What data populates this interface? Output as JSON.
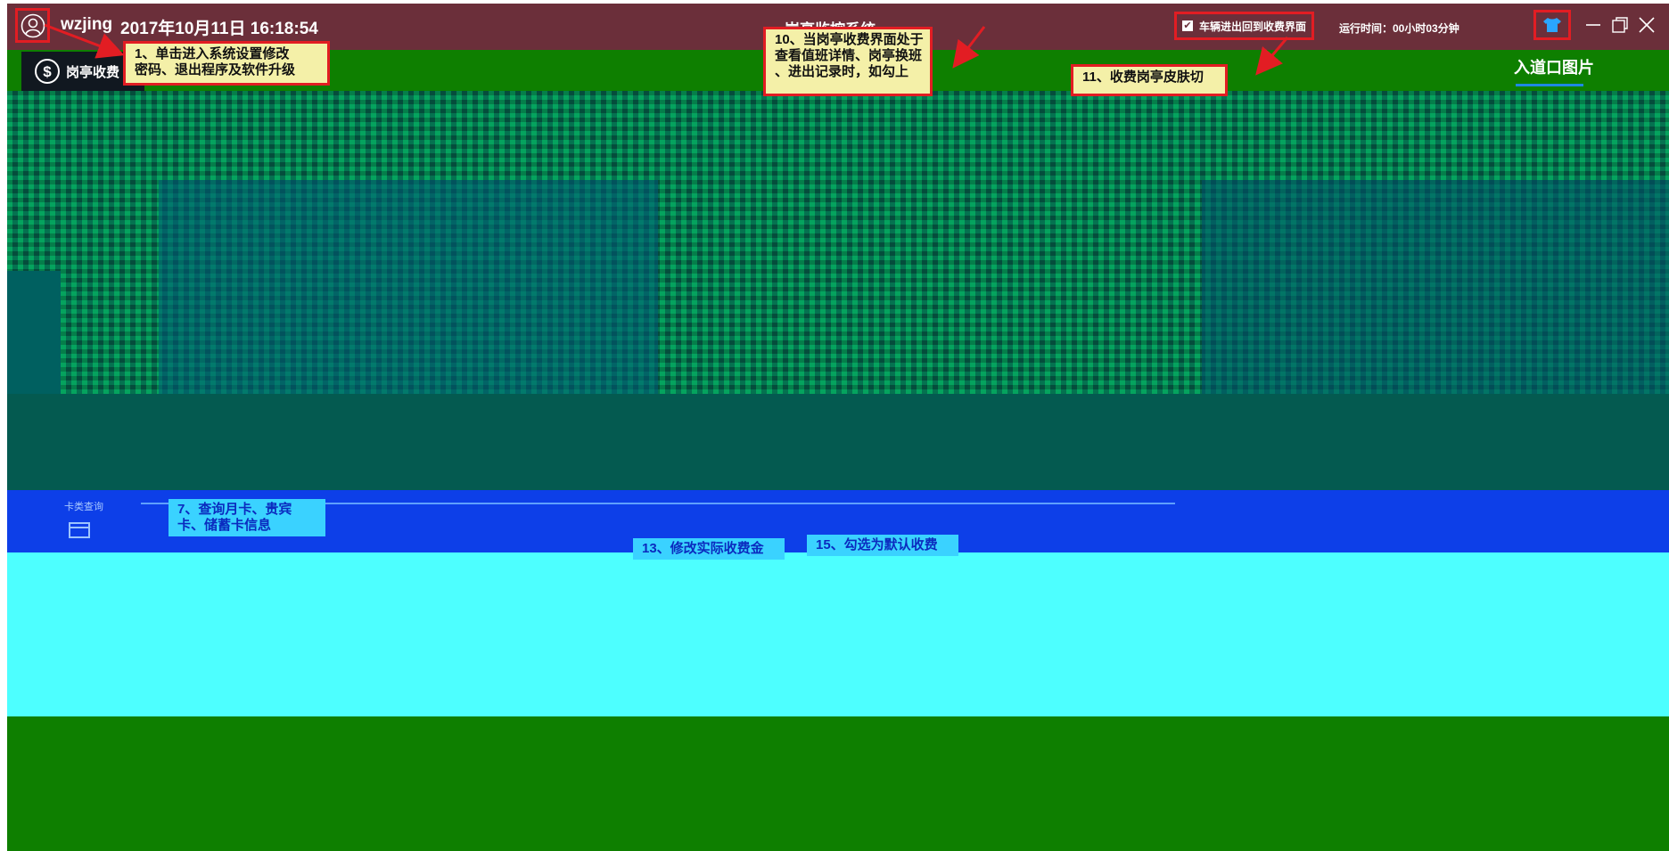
{
  "titlebar": {
    "user_name": "wzjing",
    "login_time": "2017年10月11日 16:18:54",
    "app_title": "岗亭监控系统",
    "return_checkbox_label": "车辆进出回到收费界面",
    "return_checkbox_checked": true,
    "runtime": "运行时间：00小时03分钟",
    "icons": [
      "user-icon",
      "skin-icon",
      "minimize-icon",
      "maximize-icon",
      "close-icon"
    ]
  },
  "left_tab": {
    "label": "岗亭收费",
    "icon": "dollar-circle-icon"
  },
  "entrance_tab": {
    "label": "入道口图片"
  },
  "query": {
    "label": "卡类查询"
  },
  "callouts": {
    "c1": "1、单击进入系统设置修改\n密码、退出程序及软件升级",
    "c10": "10、当岗亭收费界面处于\n查看值班详情、岗亭换班\n、进出记录时，如勾上",
    "c11": "11、收费岗亭皮肤切",
    "c7": "7、查询月卡、贵宾\n卡、储蓄卡信息",
    "c13": "13、修改实际收费金",
    "c15": "15、勾选为默认收费"
  },
  "colors": {
    "titlebar": "#6b2f3a",
    "annotation_border": "#e21d23",
    "callout_bg": "#f4f0a8",
    "query_bar": "#0d3fe8",
    "bottom_area": "#4dffff"
  }
}
